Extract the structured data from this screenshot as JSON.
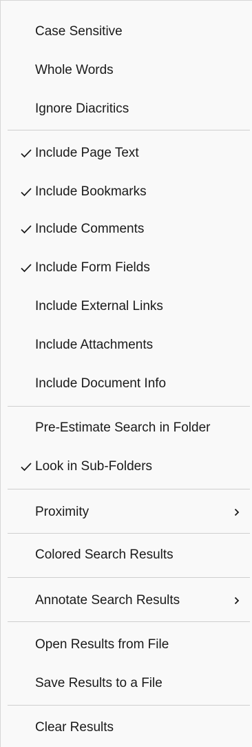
{
  "menu": {
    "items": [
      {
        "label": "Case Sensitive",
        "checked": false
      },
      {
        "label": "Whole Words",
        "checked": false
      },
      {
        "label": "Ignore Diacritics",
        "checked": false
      },
      {
        "label": "Include Page Text",
        "checked": true
      },
      {
        "label": "Include Bookmarks",
        "checked": true
      },
      {
        "label": "Include Comments",
        "checked": true
      },
      {
        "label": "Include Form Fields",
        "checked": true
      },
      {
        "label": "Include External Links",
        "checked": false
      },
      {
        "label": "Include Attachments",
        "checked": false
      },
      {
        "label": "Include Document Info",
        "checked": false
      },
      {
        "label": "Pre-Estimate Search in Folder",
        "checked": false
      },
      {
        "label": "Look in Sub-Folders",
        "checked": true
      },
      {
        "label": "Proximity",
        "checked": false,
        "submenu": true,
        "chevron_icon": "chevron-right-icon"
      },
      {
        "label": "Colored Search Results",
        "checked": false
      },
      {
        "label": "Annotate Search Results",
        "checked": false,
        "submenu": true,
        "chevron_icon": "chevron-right-icon"
      },
      {
        "label": "Open Results from File",
        "checked": false
      },
      {
        "label": "Save Results to a File",
        "checked": false
      },
      {
        "label": "Clear Results",
        "checked": false
      }
    ],
    "check_icon": "checkmark-icon",
    "colors": {
      "background": "#f9f9f9",
      "text": "#1a1a1a",
      "separator": "#cfcfcf"
    }
  }
}
